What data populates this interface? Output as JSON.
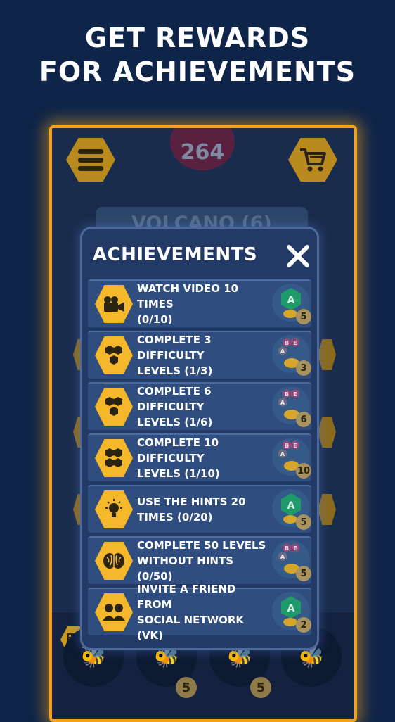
{
  "promo": {
    "line1": "GET REWARDS",
    "line2": "FOR ACHIEVEMENTS"
  },
  "game": {
    "score": "264",
    "level_label": "VOLCANO (6)",
    "bottom_badges": [
      "5",
      "5"
    ]
  },
  "modal": {
    "title": "ACHIEVEMENTS",
    "close_icon": "close-x-icon",
    "items": [
      {
        "icon": "video-camera-icon",
        "line1": "WATCH VIDEO 10 TIMES",
        "line2": "(0/10)",
        "reward": "5",
        "reward_type": "letter-a"
      },
      {
        "icon": "hexagon-cluster-icon",
        "line1": "COMPLETE 3 DIFFICULTY",
        "line2": "LEVELS (1/3)",
        "reward": "3",
        "reward_type": "letters-abe"
      },
      {
        "icon": "hexagon-cluster-icon",
        "line1": "COMPLETE 6 DIFFICULTY",
        "line2": "LEVELS (1/6)",
        "reward": "6",
        "reward_type": "letters-abe"
      },
      {
        "icon": "hexagon-cluster-icon",
        "line1": "COMPLETE 10 DIFFICULTY",
        "line2": "LEVELS (1/10)",
        "reward": "10",
        "reward_type": "letters-abe"
      },
      {
        "icon": "lightbulb-icon",
        "line1": "USE THE HINTS 20",
        "line2": "TIMES (0/20)",
        "reward": "5",
        "reward_type": "letter-a"
      },
      {
        "icon": "brain-icon",
        "line1": "COMPLETE 50 LEVELS",
        "line2": "WITHOUT HINTS (0/50)",
        "reward": "5",
        "reward_type": "letters-abe"
      },
      {
        "icon": "friends-icon",
        "line1": "INVITE A FRIEND FROM",
        "line2": "SOCIAL NETWORK (VK)",
        "reward": "2",
        "reward_type": "letter-a"
      }
    ]
  },
  "colors": {
    "background": "#0e2448",
    "frame_glow": "#f5a21a",
    "modal_bg": "#243a66",
    "row_bg": "#304d80",
    "icon_hex": "#f4b82a"
  }
}
